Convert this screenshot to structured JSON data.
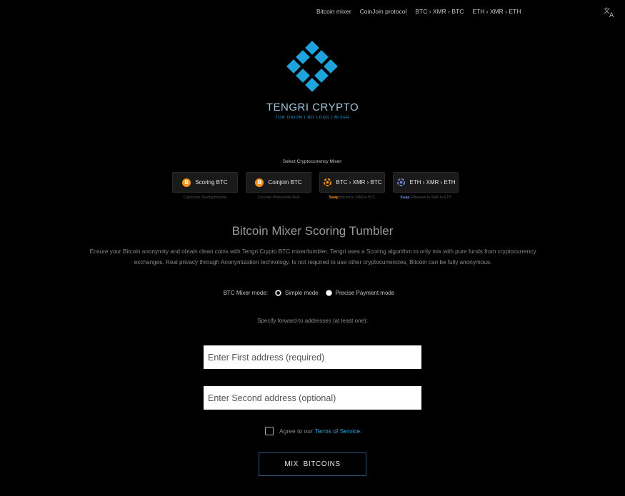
{
  "nav": {
    "items": [
      "Bitcoin mixer",
      "CoinJoin protocol",
      "BTC › XMR › BTC",
      "ETH › XMR › ETH"
    ]
  },
  "icons": {
    "translate": "translate-icon",
    "logo": "tengri-diamond-logo",
    "bitcoin": "bitcoin-coin-icon",
    "swap_btc": "orange-swirl-icon",
    "swap_eth": "blue-swirl-icon"
  },
  "brand": {
    "name": "TENGRI CRYPTO",
    "tagline": "TOR ONION | NO LOGS | MIXER"
  },
  "mixers": {
    "select_label": "Select Cryptocurrency Mixer:",
    "items": [
      {
        "label": "Scoring BTC",
        "sub": "Cryptocoin Scoring Bitcoins",
        "sub_tag": ""
      },
      {
        "label": "Coinjoin BTC",
        "sub": "CoinJoin Protocol Re-Built",
        "sub_tag": ""
      },
      {
        "label": "BTC › XMR › BTC",
        "sub": "Bitcoin to XMR to BTC",
        "sub_tag": "Swap"
      },
      {
        "label": "ETH › XMR › ETH",
        "sub": "Ethereum to XMR to ETH",
        "sub_tag": "Swap"
      }
    ]
  },
  "main": {
    "title": "Bitcoin Mixer Scoring Tumbler",
    "description": "Ensure your Bitcoin anonymity and obtain clean coins with Tengri Crypto BTC mixer/tumbler. Tengri uses a Scoring algorithm to only mix with pure funds from cryptocurrency exchanges. Real privacy through Anonymization technology. Is not required to use other cryptocurrencies, Bitcoin can be fully anonymous."
  },
  "mode": {
    "label": "BTC Mixer mode:",
    "options": [
      "Simple mode",
      "Precise Payment mode"
    ],
    "selected": "Simple mode"
  },
  "form": {
    "forward_label": "Specify forward-to addresses (at least one):",
    "address1_placeholder": "Enter First address (required)",
    "address2_placeholder": "Enter Second address (optional)",
    "address1_value": "",
    "address2_value": "",
    "agree_text": "Agree to our",
    "tos_link": "Terms of Service.",
    "agreed": false,
    "submit": "MIX  BITCOINS"
  },
  "colors": {
    "background": "#000000",
    "accent": "#29a9e0",
    "bitcoin": "#f7931a",
    "logo": "#1fa3dc",
    "swap_btc": "#f7931a",
    "swap_eth": "#6f86d6",
    "button_border": "#2c5078"
  }
}
